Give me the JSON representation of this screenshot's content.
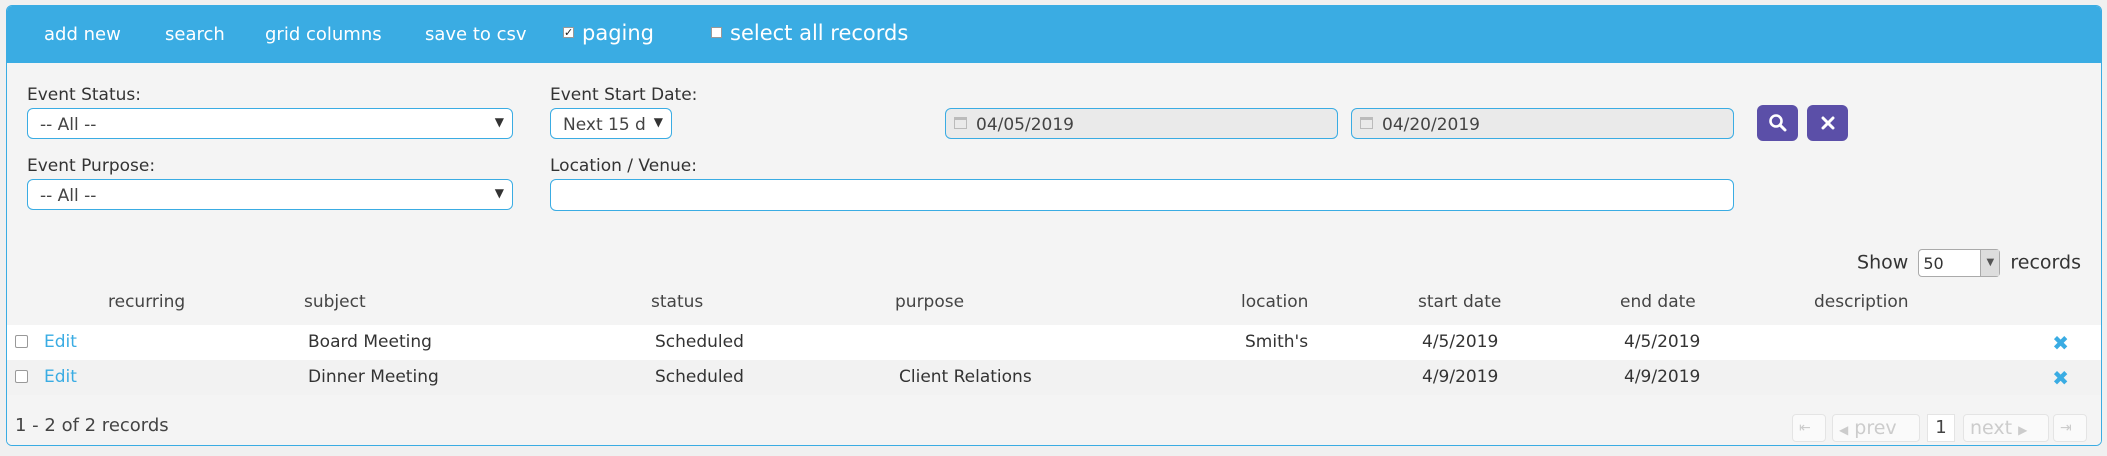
{
  "toolbar": {
    "add_new": "add new",
    "search": "search",
    "grid_columns": "grid columns",
    "save_to_csv": "save to csv",
    "paging": "paging",
    "paging_checked": true,
    "select_all": "select all records",
    "select_all_checked": false
  },
  "filters": {
    "event_status_label": "Event Status:",
    "event_status_value": "-- All --",
    "event_start_date_label": "Event Start Date:",
    "event_start_date_value": "Next 15 d",
    "date_from": "04/05/2019",
    "date_to": "04/20/2019",
    "event_purpose_label": "Event Purpose:",
    "event_purpose_value": "-- All --",
    "location_label": "Location / Venue:",
    "location_value": ""
  },
  "grid": {
    "show_label": "Show",
    "page_size": "50",
    "records_label": "records",
    "columns": [
      "recurring",
      "subject",
      "status",
      "purpose",
      "location",
      "start date",
      "end date",
      "description"
    ],
    "rows": [
      {
        "edit": "Edit",
        "recurring": "",
        "subject": "Board Meeting",
        "status": "Scheduled",
        "purpose": "",
        "location": "Smith's",
        "start_date": "4/5/2019",
        "end_date": "4/5/2019",
        "description": ""
      },
      {
        "edit": "Edit",
        "recurring": "",
        "subject": "Dinner Meeting",
        "status": "Scheduled",
        "purpose": "Client Relations",
        "location": "",
        "start_date": "4/9/2019",
        "end_date": "4/9/2019",
        "description": ""
      }
    ],
    "record_count": "1 - 2 of 2 records",
    "pager": {
      "first": "⇤",
      "prev": "prev",
      "page": "1",
      "next": "next",
      "last": "⇥"
    }
  },
  "icons": {
    "search": "search-icon",
    "clear": "close-icon",
    "calendar": "calendar-icon",
    "delete": "delete-icon"
  },
  "colors": {
    "accent": "#3aace3",
    "button": "#5b4fa8"
  }
}
